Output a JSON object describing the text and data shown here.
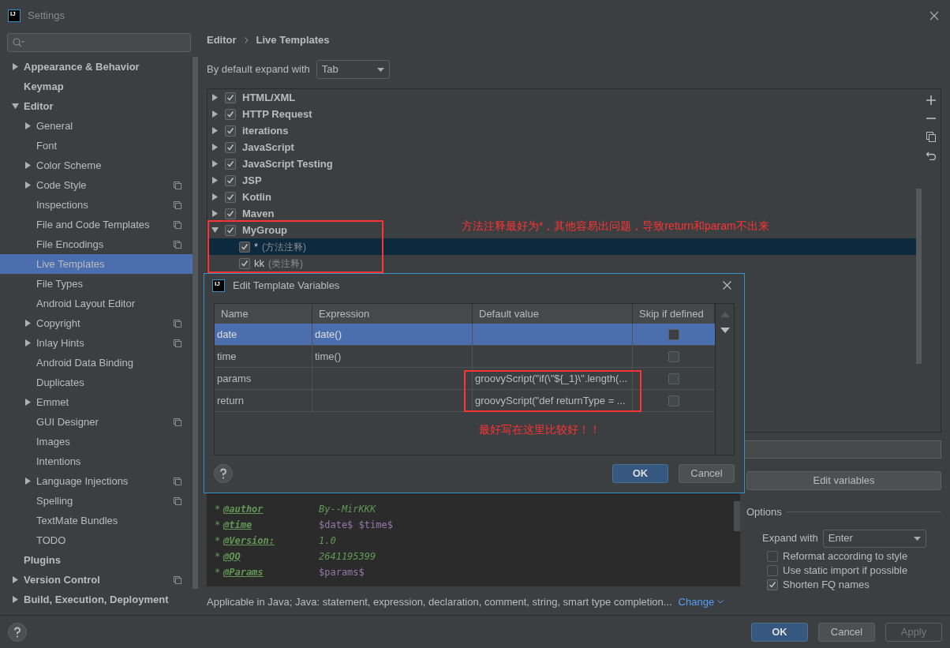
{
  "window": {
    "logo": "IJ",
    "title": "Settings"
  },
  "sidebar": {
    "items": [
      {
        "label": "Appearance & Behavior",
        "expanded": false,
        "selected": false
      },
      {
        "label": "Keymap",
        "selected": false
      },
      {
        "label": "Editor",
        "expanded": true,
        "selected": false,
        "children": [
          {
            "label": "General",
            "expanded": false,
            "selected": false
          },
          {
            "label": "Font",
            "selected": false
          },
          {
            "label": "Color Scheme",
            "expanded": false,
            "selected": false
          },
          {
            "label": "Code Style",
            "expanded": false,
            "scoped": true,
            "selected": false
          },
          {
            "label": "Inspections",
            "scoped": true,
            "selected": false
          },
          {
            "label": "File and Code Templates",
            "scoped": true,
            "selected": false
          },
          {
            "label": "File Encodings",
            "scoped": true,
            "selected": false
          },
          {
            "label": "Live Templates",
            "selected": true
          },
          {
            "label": "File Types",
            "selected": false
          },
          {
            "label": "Android Layout Editor",
            "selected": false
          },
          {
            "label": "Copyright",
            "expanded": false,
            "scoped": true,
            "selected": false
          },
          {
            "label": "Inlay Hints",
            "expanded": false,
            "scoped": true,
            "selected": false
          },
          {
            "label": "Android Data Binding",
            "selected": false
          },
          {
            "label": "Duplicates",
            "selected": false
          },
          {
            "label": "Emmet",
            "expanded": false,
            "selected": false
          },
          {
            "label": "GUI Designer",
            "scoped": true,
            "selected": false
          },
          {
            "label": "Images",
            "selected": false
          },
          {
            "label": "Intentions",
            "selected": false
          },
          {
            "label": "Language Injections",
            "expanded": false,
            "scoped": true,
            "selected": false
          },
          {
            "label": "Spelling",
            "scoped": true,
            "selected": false
          },
          {
            "label": "TextMate Bundles",
            "selected": false
          },
          {
            "label": "TODO",
            "selected": false
          }
        ]
      },
      {
        "label": "Plugins",
        "selected": false
      },
      {
        "label": "Version Control",
        "expanded": false,
        "scoped": true,
        "selected": false
      },
      {
        "label": "Build, Execution, Deployment",
        "expanded": false,
        "selected": false
      }
    ]
  },
  "breadcrumb": [
    "Editor",
    "Live Templates"
  ],
  "expand_default": {
    "label": "By default expand with",
    "value": "Tab"
  },
  "template_tree": [
    {
      "label": "HTML/XML",
      "checked": true,
      "expanded": false,
      "selected": false
    },
    {
      "label": "HTTP Request",
      "checked": true,
      "expanded": false,
      "selected": false
    },
    {
      "label": "iterations",
      "checked": true,
      "expanded": false,
      "selected": false
    },
    {
      "label": "JavaScript",
      "checked": true,
      "expanded": false,
      "selected": false
    },
    {
      "label": "JavaScript Testing",
      "checked": true,
      "expanded": false,
      "selected": false
    },
    {
      "label": "JSP",
      "checked": true,
      "expanded": false,
      "selected": false
    },
    {
      "label": "Kotlin",
      "checked": true,
      "expanded": false,
      "selected": false
    },
    {
      "label": "Maven",
      "checked": true,
      "expanded": false,
      "selected": false
    },
    {
      "label": "MyGroup",
      "checked": true,
      "expanded": true,
      "selected": false,
      "children": [
        {
          "name": "*",
          "description": "(方法注释)",
          "checked": true,
          "selected": true
        },
        {
          "name": "kk",
          "description": "(类注释)",
          "checked": true,
          "selected": false
        }
      ]
    }
  ],
  "template_text": [
    {
      "tag": "@author",
      "value": "By--MirKKK",
      "kind": "literal"
    },
    {
      "tag": "@time",
      "value": "$date$ $time$",
      "kind": "variable"
    },
    {
      "tag": "@Version:",
      "value": "1.0",
      "kind": "literal"
    },
    {
      "tag": "@QQ",
      "value": "2641195399",
      "kind": "literal"
    },
    {
      "tag": "@Params",
      "value": "$params$",
      "kind": "variable"
    }
  ],
  "applicable": {
    "text": "Applicable in Java; Java: statement, expression, declaration, comment, string, smart type completion...",
    "link": "Change"
  },
  "edit_variables_button": "Edit variables",
  "options": {
    "title": "Options",
    "expand_with": {
      "label": "Expand with",
      "value": "Enter"
    },
    "checkboxes": [
      {
        "label": "Reformat according to style",
        "checked": false
      },
      {
        "label": "Use static import if possible",
        "checked": false
      },
      {
        "label": "Shorten FQ names",
        "checked": true
      }
    ]
  },
  "dialog": {
    "logo": "IJ",
    "title": "Edit Template Variables",
    "columns": [
      "Name",
      "Expression",
      "Default value",
      "Skip if defined"
    ],
    "rows": [
      {
        "name": "date",
        "expression": "date()",
        "skip_if_defined": false,
        "selected": true
      },
      {
        "name": "time",
        "expression": "time()",
        "skip_if_defined": false,
        "selected": false
      },
      {
        "name": "params",
        "default_value": "groovyScript(\"if(\\\"${_1}\\\".length(...",
        "skip_if_defined": false,
        "selected": false
      },
      {
        "name": "return",
        "default_value": "groovyScript(\"def returnType = ...",
        "skip_if_defined": false,
        "selected": false
      }
    ],
    "buttons": [
      "OK",
      "Cancel"
    ]
  },
  "annotations": [
    "方法注释最好为*，其他容易出问题，导致return和param不出来",
    "最好写在这里比较好！！"
  ],
  "footer_buttons": [
    {
      "label": "OK",
      "kind": "primary"
    },
    {
      "label": "Cancel",
      "kind": "normal"
    },
    {
      "label": "Apply",
      "kind": "disabled"
    }
  ]
}
